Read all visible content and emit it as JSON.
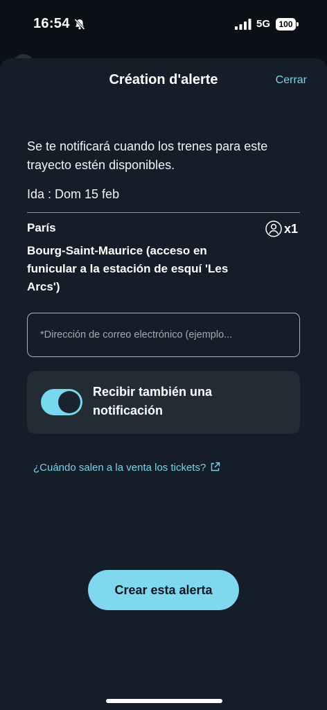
{
  "status_bar": {
    "time": "16:54",
    "network": "5G",
    "battery": "100"
  },
  "sheet": {
    "title": "Création d'alerte",
    "close_label": "Cerrar",
    "description": "Se te notificará cuando los trenes para este trayecto estén disponibles.",
    "date_line": "Ida : Dom 15 feb",
    "origin": "París",
    "passenger_count": "x1",
    "destination": "Bourg-Saint-Maurice (acceso en funicular a la estación de esquí 'Les Arcs')",
    "email": {
      "value": "",
      "placeholder": "*Dirección de correo electrónico (ejemplo..."
    },
    "notification": {
      "label": "Recibir también una notificación",
      "enabled": true
    },
    "tickets_link": "¿Cuándo salen a la venta los tickets?",
    "create_button": "Crear esta alerta"
  },
  "icons": [
    "bell-slash-icon",
    "signal-icon",
    "battery-icon",
    "person-icon",
    "external-link-icon"
  ],
  "colors": {
    "accent": "#7fd8ee",
    "sheet_bg": "#151d28",
    "page_bg": "#0b0f16"
  }
}
